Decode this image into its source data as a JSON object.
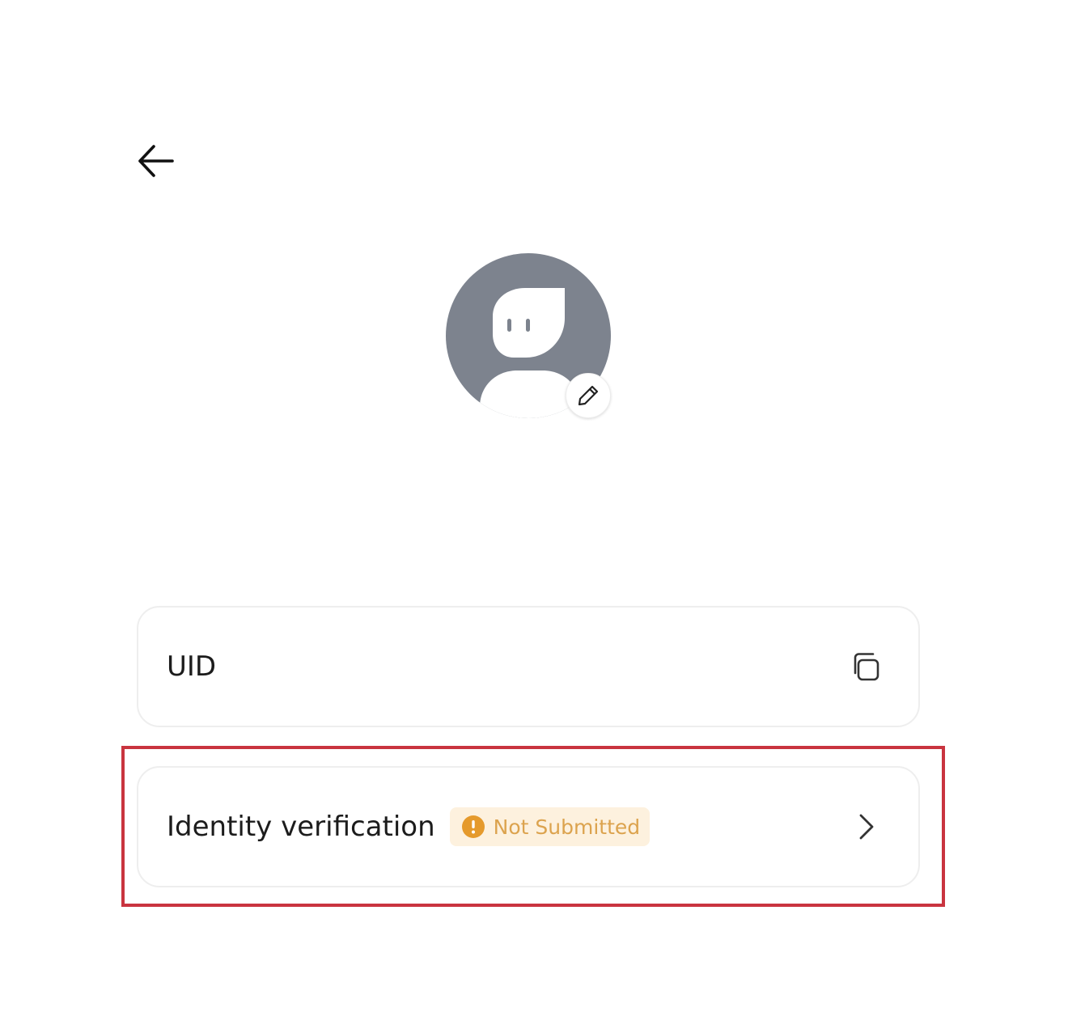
{
  "header": {
    "back_icon": "arrow-left-icon"
  },
  "profile": {
    "avatar_icon": "default-avatar-icon",
    "edit_icon": "pencil-icon",
    "nickname": ""
  },
  "uid_row": {
    "label": "UID",
    "value": "",
    "copy_icon": "copy-icon"
  },
  "identity_row": {
    "label": "Identity verification",
    "status": "Not Submitted",
    "status_icon": "exclamation-circle-icon",
    "chevron_icon": "chevron-right-icon"
  },
  "colors": {
    "avatar_bg": "#7d838e",
    "status_text": "#dca34e",
    "status_bg": "#fdf1de",
    "status_icon": "#e59a2c",
    "highlight_border": "#c9343f"
  }
}
